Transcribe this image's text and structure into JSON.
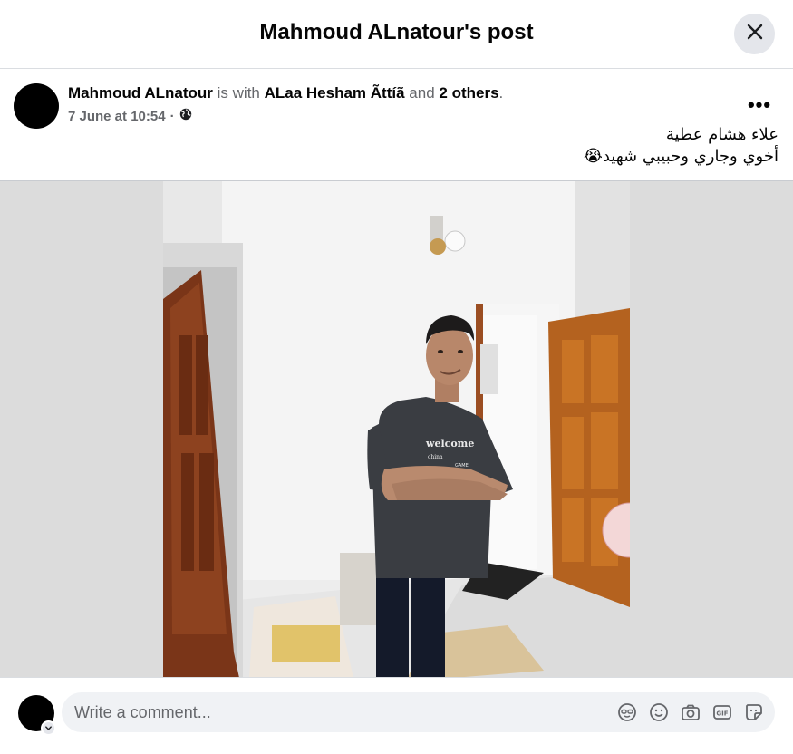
{
  "dialog": {
    "title": "Mahmoud ALnatour's post"
  },
  "post": {
    "author": "Mahmoud ALnatour",
    "with_text": "is with",
    "tagged_person": "ALaa Hesham Ãttíã",
    "and_text": "and",
    "others": "2 others",
    "period": ".",
    "date": "7 June at 10:54",
    "separator": "·",
    "audience_icon": "globe-icon",
    "more_label": "•••",
    "text_lines": [
      "علاء هشام عطية",
      "أخوي وجاري وحبيبي شهيد😭"
    ],
    "photo_icon": "photo-man-in-room"
  },
  "comment": {
    "placeholder": "Write a comment...",
    "icons": [
      "avatar-sticker-icon",
      "emoji-icon",
      "camera-icon",
      "gif-icon",
      "sticker-icon"
    ]
  },
  "colors": {
    "secondary_text": "#65676b",
    "divider": "#dadde1",
    "button_bg": "#e4e6eb",
    "input_bg": "#f0f2f5"
  }
}
